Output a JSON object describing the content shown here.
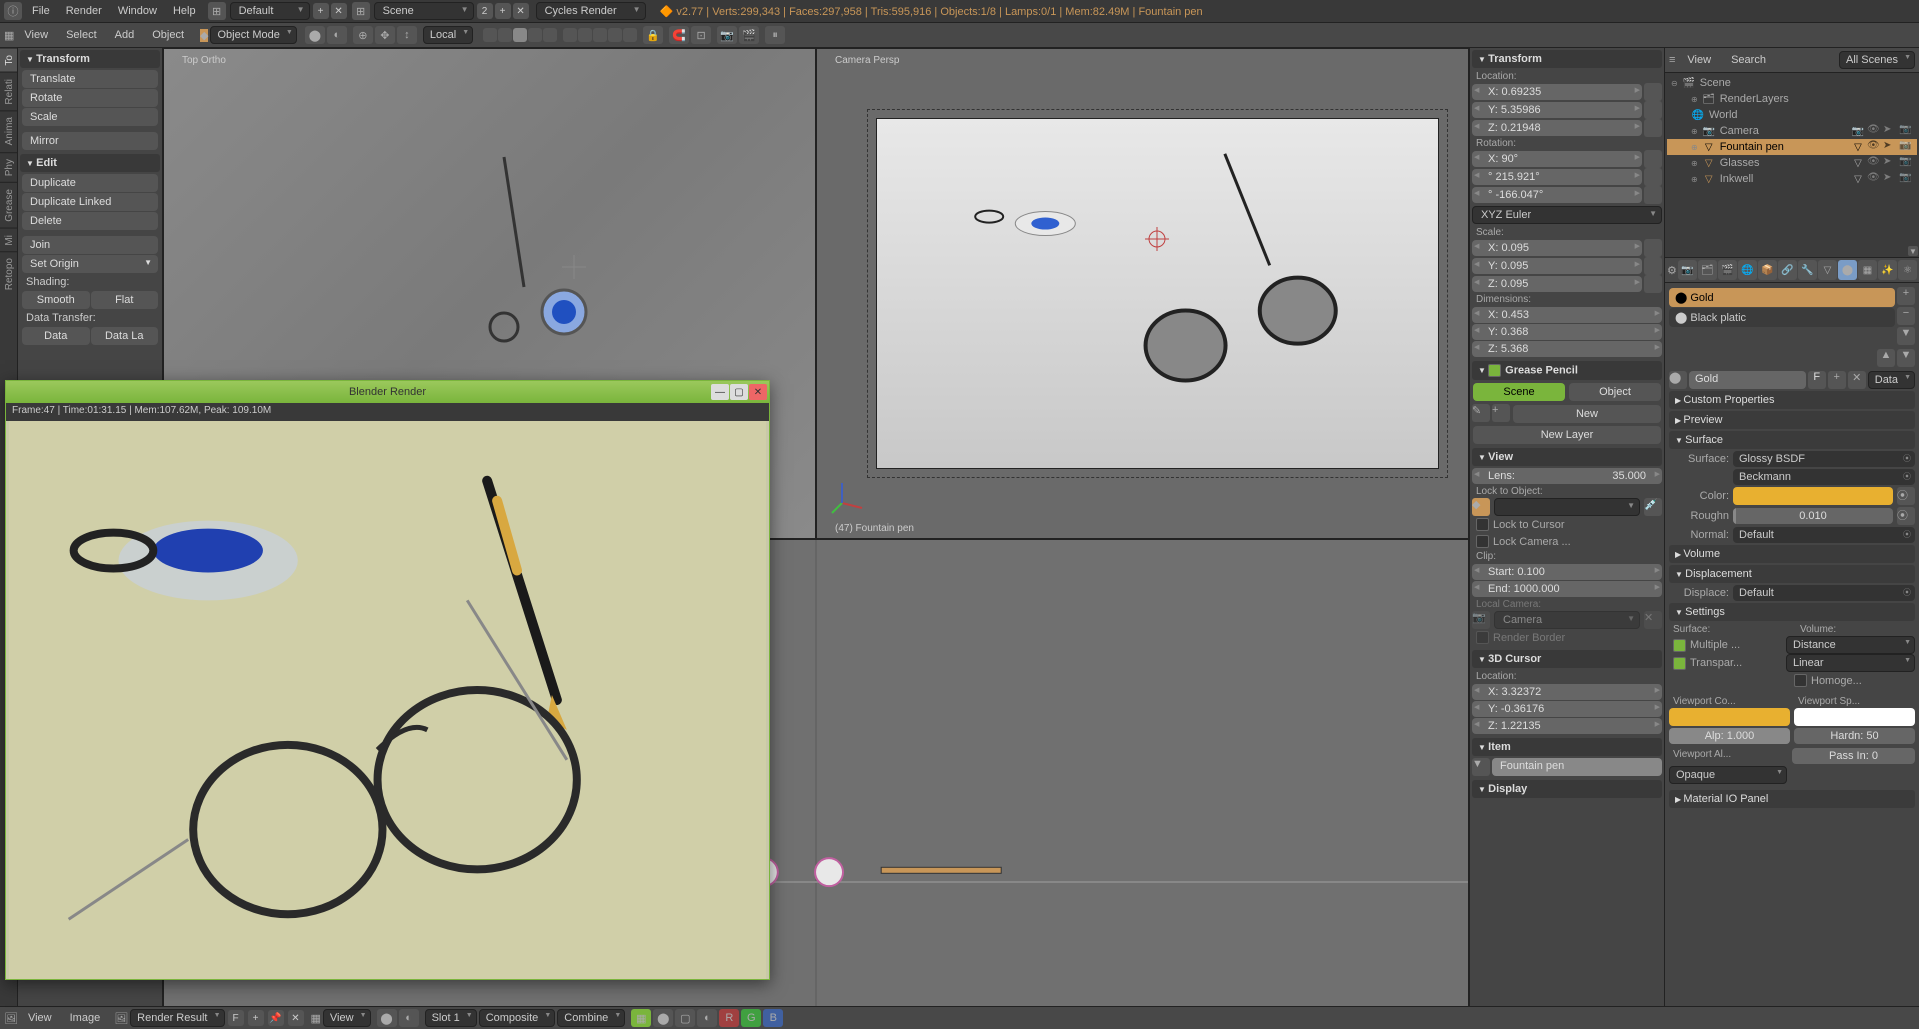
{
  "topbar": {
    "menus": [
      "File",
      "Render",
      "Window",
      "Help"
    ],
    "layout": "Default",
    "scene": "Scene",
    "scene_count": "2",
    "engine": "Cycles Render",
    "version": "v2.77",
    "stats": "Verts:299,343 | Faces:297,958 | Tris:595,916 | Objects:1/8 | Lamps:0/1 | Mem:82.49M | Fountain pen"
  },
  "header2": {
    "menus": [
      "View",
      "Select",
      "Add",
      "Object"
    ],
    "mode": "Object Mode",
    "orientation": "Local"
  },
  "left_tabs": [
    "To",
    "Relati",
    "Anima",
    "Phy",
    "Grease",
    "Mi",
    "Retopo"
  ],
  "tool_panel": {
    "transform_header": "Transform",
    "translate": "Translate",
    "rotate": "Rotate",
    "scale": "Scale",
    "mirror": "Mirror",
    "edit_header": "Edit",
    "duplicate": "Duplicate",
    "duplicate_linked": "Duplicate Linked",
    "delete": "Delete",
    "join": "Join",
    "set_origin": "Set Origin",
    "shading_label": "Shading:",
    "smooth": "Smooth",
    "flat": "Flat",
    "data_transfer_label": "Data Transfer:",
    "data": "Data",
    "data_la": "Data La"
  },
  "viewports": {
    "top_ortho": "Top Ortho",
    "camera_persp": "Camera Persp",
    "obj_info": "(47) Fountain pen"
  },
  "n_panel": {
    "transform_header": "Transform",
    "location_label": "Location:",
    "loc_x": "X: 0.69235",
    "loc_y": "Y: 5.35986",
    "loc_z": "Z: 0.21948",
    "rotation_label": "Rotation:",
    "rot_x": "X:        90°",
    "rot_y": "° 215.921°",
    "rot_z": "° -166.047°",
    "rot_mode": "XYZ Euler",
    "scale_label": "Scale:",
    "scale_x": "X:      0.095",
    "scale_y": "Y:      0.095",
    "scale_z": "Z:      0.095",
    "dimensions_label": "Dimensions:",
    "dim_x": "X:      0.453",
    "dim_y": "Y:      0.368",
    "dim_z": "Z:      5.368",
    "gp_header": "Grease Pencil",
    "gp_scene": "Scene",
    "gp_object": "Object",
    "gp_new": "New",
    "gp_new_layer": "New Layer",
    "view_header": "View",
    "lens_label": "Lens:",
    "lens_val": "35.000",
    "lock_obj": "Lock to Object:",
    "lock_cursor": "Lock to Cursor",
    "lock_camera": "Lock Camera ...",
    "clip_label": "Clip:",
    "clip_start": "Start:     0.100",
    "clip_end": "End: 1000.000",
    "local_camera": "Local Camera:",
    "camera": "Camera",
    "render_border": "Render Border",
    "cursor_header": "3D Cursor",
    "cursor_loc": "Location:",
    "cur_x": "X:    3.32372",
    "cur_y": "Y:   -0.36176",
    "cur_z": "Z:    1.22135",
    "item_header": "Item",
    "item_name": "Fountain pen",
    "display_header": "Display"
  },
  "outliner": {
    "menus": [
      "View",
      "Search"
    ],
    "filter": "All Scenes",
    "scene": "Scene",
    "render_layers": "RenderLayers",
    "world": "World",
    "camera": "Camera",
    "fountain_pen": "Fountain pen",
    "glasses": "Glasses",
    "inkwell": "Inkwell"
  },
  "props": {
    "mat_gold": "Gold",
    "mat_black": "Black platic",
    "mat_name": "Gold",
    "mat_f": "F",
    "data_btn": "Data",
    "custom_props": "Custom Properties",
    "preview": "Preview",
    "surface_hdr": "Surface",
    "surface_label": "Surface:",
    "surface_val": "Glossy BSDF",
    "distribution": "Beckmann",
    "color_label": "Color:",
    "roughness_label": "Roughn",
    "roughness_val": "0.010",
    "normal_label": "Normal:",
    "normal_val": "Default",
    "volume_hdr": "Volume",
    "displacement_hdr": "Displacement",
    "displace_label": "Displace:",
    "displace_val": "Default",
    "settings_hdr": "Settings",
    "surf_label": "Surface:",
    "vol_label": "Volume:",
    "multiple": "Multiple ...",
    "distance": "Distance",
    "transpar": "Transpar...",
    "linear": "Linear",
    "homoge": "Homoge...",
    "vp_color": "Viewport Co...",
    "vp_spec": "Viewport Sp...",
    "alp": "Alp: 1.000",
    "hardn": "Hardn: 50",
    "vp_al": "Viewport Al...",
    "pass_in": "Pass In: 0",
    "opaque": "Opaque",
    "mat_io": "Material IO Panel"
  },
  "render_window": {
    "title": "Blender Render",
    "status": "Frame:47 | Time:01:31.15 | Mem:107.62M, Peak: 109.10M"
  },
  "bottom_bar": {
    "view": "View",
    "image": "Image",
    "render_result": "Render Result",
    "f": "F",
    "view2": "View",
    "slot": "Slot 1",
    "composite": "Composite",
    "combine": "Combine"
  }
}
